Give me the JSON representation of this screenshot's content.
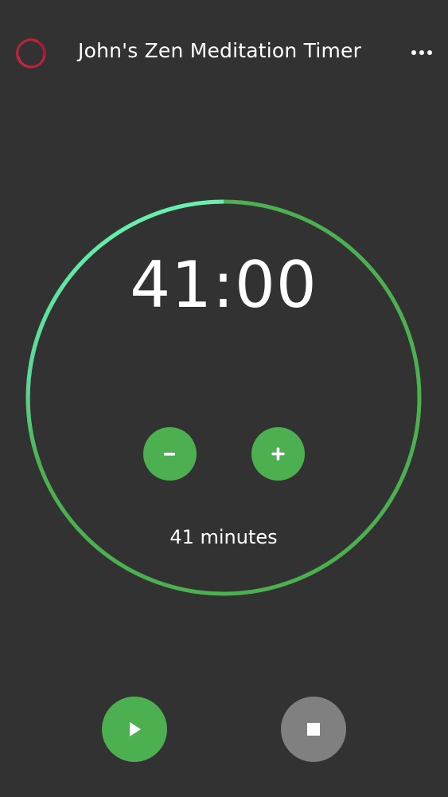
{
  "header": {
    "title": "John's Zen Meditation Timer",
    "logo_icon": "enso-circle-icon",
    "menu_icon": "more-horizontal-icon"
  },
  "timer": {
    "display": "41:00",
    "minutes_label": "41 minutes",
    "decrease_icon": "minus-icon",
    "increase_icon": "plus-icon"
  },
  "controls": {
    "play_icon": "play-icon",
    "stop_icon": "stop-icon"
  },
  "colors": {
    "background": "#323232",
    "accent_green": "#4caf50",
    "ring_start": "#69f0ae",
    "ring_end": "#4caf50",
    "stop_gray": "#808080",
    "logo_red": "#b8233c"
  }
}
